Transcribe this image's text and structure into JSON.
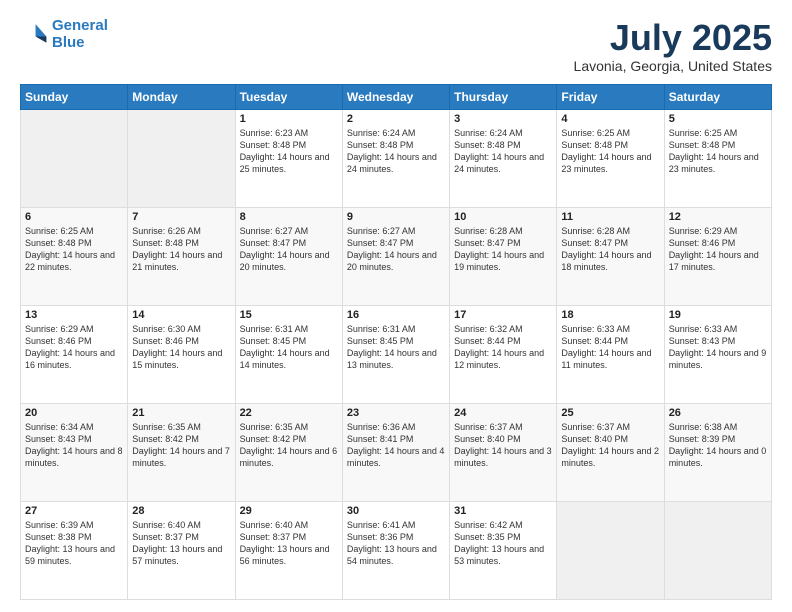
{
  "logo": {
    "line1": "General",
    "line2": "Blue"
  },
  "title": "July 2025",
  "subtitle": "Lavonia, Georgia, United States",
  "days_header": [
    "Sunday",
    "Monday",
    "Tuesday",
    "Wednesday",
    "Thursday",
    "Friday",
    "Saturday"
  ],
  "weeks": [
    [
      {
        "day": "",
        "sunrise": "",
        "sunset": "",
        "daylight": ""
      },
      {
        "day": "",
        "sunrise": "",
        "sunset": "",
        "daylight": ""
      },
      {
        "day": "1",
        "sunrise": "Sunrise: 6:23 AM",
        "sunset": "Sunset: 8:48 PM",
        "daylight": "Daylight: 14 hours and 25 minutes."
      },
      {
        "day": "2",
        "sunrise": "Sunrise: 6:24 AM",
        "sunset": "Sunset: 8:48 PM",
        "daylight": "Daylight: 14 hours and 24 minutes."
      },
      {
        "day": "3",
        "sunrise": "Sunrise: 6:24 AM",
        "sunset": "Sunset: 8:48 PM",
        "daylight": "Daylight: 14 hours and 24 minutes."
      },
      {
        "day": "4",
        "sunrise": "Sunrise: 6:25 AM",
        "sunset": "Sunset: 8:48 PM",
        "daylight": "Daylight: 14 hours and 23 minutes."
      },
      {
        "day": "5",
        "sunrise": "Sunrise: 6:25 AM",
        "sunset": "Sunset: 8:48 PM",
        "daylight": "Daylight: 14 hours and 23 minutes."
      }
    ],
    [
      {
        "day": "6",
        "sunrise": "Sunrise: 6:25 AM",
        "sunset": "Sunset: 8:48 PM",
        "daylight": "Daylight: 14 hours and 22 minutes."
      },
      {
        "day": "7",
        "sunrise": "Sunrise: 6:26 AM",
        "sunset": "Sunset: 8:48 PM",
        "daylight": "Daylight: 14 hours and 21 minutes."
      },
      {
        "day": "8",
        "sunrise": "Sunrise: 6:27 AM",
        "sunset": "Sunset: 8:47 PM",
        "daylight": "Daylight: 14 hours and 20 minutes."
      },
      {
        "day": "9",
        "sunrise": "Sunrise: 6:27 AM",
        "sunset": "Sunset: 8:47 PM",
        "daylight": "Daylight: 14 hours and 20 minutes."
      },
      {
        "day": "10",
        "sunrise": "Sunrise: 6:28 AM",
        "sunset": "Sunset: 8:47 PM",
        "daylight": "Daylight: 14 hours and 19 minutes."
      },
      {
        "day": "11",
        "sunrise": "Sunrise: 6:28 AM",
        "sunset": "Sunset: 8:47 PM",
        "daylight": "Daylight: 14 hours and 18 minutes."
      },
      {
        "day": "12",
        "sunrise": "Sunrise: 6:29 AM",
        "sunset": "Sunset: 8:46 PM",
        "daylight": "Daylight: 14 hours and 17 minutes."
      }
    ],
    [
      {
        "day": "13",
        "sunrise": "Sunrise: 6:29 AM",
        "sunset": "Sunset: 8:46 PM",
        "daylight": "Daylight: 14 hours and 16 minutes."
      },
      {
        "day": "14",
        "sunrise": "Sunrise: 6:30 AM",
        "sunset": "Sunset: 8:46 PM",
        "daylight": "Daylight: 14 hours and 15 minutes."
      },
      {
        "day": "15",
        "sunrise": "Sunrise: 6:31 AM",
        "sunset": "Sunset: 8:45 PM",
        "daylight": "Daylight: 14 hours and 14 minutes."
      },
      {
        "day": "16",
        "sunrise": "Sunrise: 6:31 AM",
        "sunset": "Sunset: 8:45 PM",
        "daylight": "Daylight: 14 hours and 13 minutes."
      },
      {
        "day": "17",
        "sunrise": "Sunrise: 6:32 AM",
        "sunset": "Sunset: 8:44 PM",
        "daylight": "Daylight: 14 hours and 12 minutes."
      },
      {
        "day": "18",
        "sunrise": "Sunrise: 6:33 AM",
        "sunset": "Sunset: 8:44 PM",
        "daylight": "Daylight: 14 hours and 11 minutes."
      },
      {
        "day": "19",
        "sunrise": "Sunrise: 6:33 AM",
        "sunset": "Sunset: 8:43 PM",
        "daylight": "Daylight: 14 hours and 9 minutes."
      }
    ],
    [
      {
        "day": "20",
        "sunrise": "Sunrise: 6:34 AM",
        "sunset": "Sunset: 8:43 PM",
        "daylight": "Daylight: 14 hours and 8 minutes."
      },
      {
        "day": "21",
        "sunrise": "Sunrise: 6:35 AM",
        "sunset": "Sunset: 8:42 PM",
        "daylight": "Daylight: 14 hours and 7 minutes."
      },
      {
        "day": "22",
        "sunrise": "Sunrise: 6:35 AM",
        "sunset": "Sunset: 8:42 PM",
        "daylight": "Daylight: 14 hours and 6 minutes."
      },
      {
        "day": "23",
        "sunrise": "Sunrise: 6:36 AM",
        "sunset": "Sunset: 8:41 PM",
        "daylight": "Daylight: 14 hours and 4 minutes."
      },
      {
        "day": "24",
        "sunrise": "Sunrise: 6:37 AM",
        "sunset": "Sunset: 8:40 PM",
        "daylight": "Daylight: 14 hours and 3 minutes."
      },
      {
        "day": "25",
        "sunrise": "Sunrise: 6:37 AM",
        "sunset": "Sunset: 8:40 PM",
        "daylight": "Daylight: 14 hours and 2 minutes."
      },
      {
        "day": "26",
        "sunrise": "Sunrise: 6:38 AM",
        "sunset": "Sunset: 8:39 PM",
        "daylight": "Daylight: 14 hours and 0 minutes."
      }
    ],
    [
      {
        "day": "27",
        "sunrise": "Sunrise: 6:39 AM",
        "sunset": "Sunset: 8:38 PM",
        "daylight": "Daylight: 13 hours and 59 minutes."
      },
      {
        "day": "28",
        "sunrise": "Sunrise: 6:40 AM",
        "sunset": "Sunset: 8:37 PM",
        "daylight": "Daylight: 13 hours and 57 minutes."
      },
      {
        "day": "29",
        "sunrise": "Sunrise: 6:40 AM",
        "sunset": "Sunset: 8:37 PM",
        "daylight": "Daylight: 13 hours and 56 minutes."
      },
      {
        "day": "30",
        "sunrise": "Sunrise: 6:41 AM",
        "sunset": "Sunset: 8:36 PM",
        "daylight": "Daylight: 13 hours and 54 minutes."
      },
      {
        "day": "31",
        "sunrise": "Sunrise: 6:42 AM",
        "sunset": "Sunset: 8:35 PM",
        "daylight": "Daylight: 13 hours and 53 minutes."
      },
      {
        "day": "",
        "sunrise": "",
        "sunset": "",
        "daylight": ""
      },
      {
        "day": "",
        "sunrise": "",
        "sunset": "",
        "daylight": ""
      }
    ]
  ]
}
